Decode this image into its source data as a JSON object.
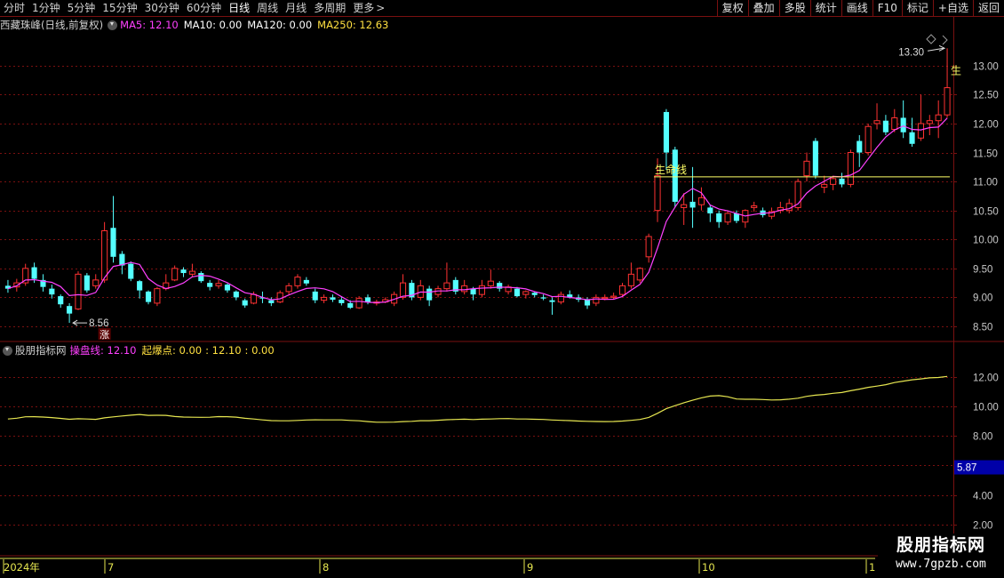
{
  "toolbar": {
    "tabs": [
      "分时",
      "1分钟",
      "5分钟",
      "15分钟",
      "30分钟",
      "60分钟",
      "日线",
      "周线",
      "月线",
      "多周期",
      "更多"
    ],
    "active_tab": "日线",
    "more_arrow": ">",
    "tools": [
      "复权",
      "叠加",
      "多股",
      "统计",
      "画线",
      "F10",
      "标记",
      "+自选",
      "返回"
    ]
  },
  "main_legend": {
    "stock": "西藏珠峰(日线,前复权)",
    "ma5": "MA5: 12.10",
    "ma10": "MA10: 0.00",
    "ma120": "MA120: 0.00",
    "ma250": "MA250: 12.63"
  },
  "sub_legend": {
    "name": "股朋指标网",
    "line1": "操盘线: 12.10",
    "line2": "起爆点: 0.00",
    "line3": ": 12.10",
    "line4": ": 0.00"
  },
  "annotations": {
    "high_label": "13.30",
    "low_label": "8.56",
    "low_marker": "涨",
    "support_label": "生命线",
    "edge_marker": "生",
    "sub_value_box": "5.87"
  },
  "watermark": {
    "line1": "股朋指标网",
    "line2": "www.7gpzb.com"
  },
  "colors": {
    "up": "#ff3232",
    "down": "#54ffff",
    "ma5": "#ff40ff",
    "indicator": "#e6e650",
    "grid": "#7a1010",
    "axis_text": "#c8c8c8",
    "support": "#ffff66",
    "value_box": "#0000a8"
  },
  "chart_data": [
    {
      "type": "candlestick",
      "x_ticks": [
        "2024年",
        "7",
        "8",
        "9",
        "10",
        "1"
      ],
      "y_ticks": [
        8.5,
        9.0,
        9.5,
        10.0,
        10.5,
        11.0,
        11.5,
        12.0,
        12.5,
        13.0
      ],
      "ylim": [
        8.3,
        13.55
      ],
      "candles": [
        {
          "o": 9.2,
          "h": 9.3,
          "l": 9.08,
          "c": 9.15
        },
        {
          "o": 9.18,
          "h": 9.32,
          "l": 9.1,
          "c": 9.25
        },
        {
          "o": 9.25,
          "h": 9.58,
          "l": 9.2,
          "c": 9.5
        },
        {
          "o": 9.52,
          "h": 9.6,
          "l": 9.25,
          "c": 9.32
        },
        {
          "o": 9.3,
          "h": 9.4,
          "l": 9.1,
          "c": 9.18
        },
        {
          "o": 9.15,
          "h": 9.22,
          "l": 8.98,
          "c": 9.05
        },
        {
          "o": 9.02,
          "h": 9.05,
          "l": 8.82,
          "c": 8.88
        },
        {
          "o": 8.85,
          "h": 8.9,
          "l": 8.56,
          "c": 8.72
        },
        {
          "o": 8.8,
          "h": 9.45,
          "l": 8.78,
          "c": 9.4
        },
        {
          "o": 9.38,
          "h": 9.42,
          "l": 9.08,
          "c": 9.12
        },
        {
          "o": 9.2,
          "h": 9.4,
          "l": 9.15,
          "c": 9.3
        },
        {
          "o": 9.3,
          "h": 10.3,
          "l": 9.25,
          "c": 10.15
        },
        {
          "o": 10.2,
          "h": 10.75,
          "l": 9.6,
          "c": 9.7
        },
        {
          "o": 9.75,
          "h": 9.8,
          "l": 9.4,
          "c": 9.55
        },
        {
          "o": 9.58,
          "h": 9.62,
          "l": 9.28,
          "c": 9.32
        },
        {
          "o": 9.28,
          "h": 9.3,
          "l": 8.98,
          "c": 9.12
        },
        {
          "o": 9.1,
          "h": 9.12,
          "l": 8.88,
          "c": 8.92
        },
        {
          "o": 8.9,
          "h": 9.18,
          "l": 8.85,
          "c": 9.15
        },
        {
          "o": 9.15,
          "h": 9.4,
          "l": 9.12,
          "c": 9.25
        },
        {
          "o": 9.3,
          "h": 9.55,
          "l": 9.28,
          "c": 9.5
        },
        {
          "o": 9.48,
          "h": 9.52,
          "l": 9.35,
          "c": 9.42
        },
        {
          "o": 9.4,
          "h": 9.58,
          "l": 9.35,
          "c": 9.45
        },
        {
          "o": 9.42,
          "h": 9.45,
          "l": 9.25,
          "c": 9.28
        },
        {
          "o": 9.25,
          "h": 9.3,
          "l": 9.12,
          "c": 9.18
        },
        {
          "o": 9.2,
          "h": 9.3,
          "l": 9.15,
          "c": 9.24
        },
        {
          "o": 9.22,
          "h": 9.24,
          "l": 9.08,
          "c": 9.12
        },
        {
          "o": 9.1,
          "h": 9.12,
          "l": 8.95,
          "c": 9.0
        },
        {
          "o": 8.95,
          "h": 8.98,
          "l": 8.82,
          "c": 8.86
        },
        {
          "o": 8.9,
          "h": 9.1,
          "l": 8.88,
          "c": 9.05
        },
        {
          "o": 9.0,
          "h": 9.1,
          "l": 8.9,
          "c": 8.98
        },
        {
          "o": 8.95,
          "h": 9.0,
          "l": 8.85,
          "c": 8.9
        },
        {
          "o": 8.92,
          "h": 9.12,
          "l": 8.9,
          "c": 9.08
        },
        {
          "o": 9.1,
          "h": 9.25,
          "l": 9.05,
          "c": 9.2
        },
        {
          "o": 9.2,
          "h": 9.4,
          "l": 9.15,
          "c": 9.35
        },
        {
          "o": 9.3,
          "h": 9.35,
          "l": 9.2,
          "c": 9.24
        },
        {
          "o": 9.1,
          "h": 9.15,
          "l": 8.9,
          "c": 8.95
        },
        {
          "o": 8.95,
          "h": 9.05,
          "l": 8.9,
          "c": 9.0
        },
        {
          "o": 9.0,
          "h": 9.05,
          "l": 8.92,
          "c": 8.96
        },
        {
          "o": 8.96,
          "h": 9.02,
          "l": 8.86,
          "c": 8.9
        },
        {
          "o": 8.9,
          "h": 8.95,
          "l": 8.8,
          "c": 8.82
        },
        {
          "o": 8.82,
          "h": 9.02,
          "l": 8.8,
          "c": 8.98
        },
        {
          "o": 9.0,
          "h": 9.05,
          "l": 8.88,
          "c": 8.92
        },
        {
          "o": 8.9,
          "h": 8.96,
          "l": 8.86,
          "c": 8.92
        },
        {
          "o": 8.92,
          "h": 9.0,
          "l": 8.9,
          "c": 8.96
        },
        {
          "o": 8.9,
          "h": 9.1,
          "l": 8.85,
          "c": 9.05
        },
        {
          "o": 9.0,
          "h": 9.4,
          "l": 8.96,
          "c": 9.25
        },
        {
          "o": 9.25,
          "h": 9.3,
          "l": 8.95,
          "c": 9.0
        },
        {
          "o": 9.0,
          "h": 9.3,
          "l": 8.95,
          "c": 9.2
        },
        {
          "o": 9.15,
          "h": 9.2,
          "l": 8.85,
          "c": 8.95
        },
        {
          "o": 9.05,
          "h": 9.2,
          "l": 9.0,
          "c": 9.15
        },
        {
          "o": 9.15,
          "h": 9.6,
          "l": 9.1,
          "c": 9.25
        },
        {
          "o": 9.3,
          "h": 9.35,
          "l": 9.05,
          "c": 9.1
        },
        {
          "o": 9.1,
          "h": 9.3,
          "l": 9.05,
          "c": 9.2
        },
        {
          "o": 9.15,
          "h": 9.18,
          "l": 8.95,
          "c": 9.05
        },
        {
          "o": 9.05,
          "h": 9.3,
          "l": 9.0,
          "c": 9.2
        },
        {
          "o": 9.2,
          "h": 9.48,
          "l": 9.15,
          "c": 9.28
        },
        {
          "o": 9.25,
          "h": 9.28,
          "l": 9.1,
          "c": 9.15
        },
        {
          "o": 9.1,
          "h": 9.22,
          "l": 9.05,
          "c": 9.18
        },
        {
          "o": 9.15,
          "h": 9.18,
          "l": 9.0,
          "c": 9.02
        },
        {
          "o": 9.05,
          "h": 9.12,
          "l": 8.98,
          "c": 9.1
        },
        {
          "o": 9.08,
          "h": 9.1,
          "l": 9.0,
          "c": 9.04
        },
        {
          "o": 9.0,
          "h": 9.05,
          "l": 8.95,
          "c": 8.98
        },
        {
          "o": 8.95,
          "h": 9.0,
          "l": 8.7,
          "c": 8.92
        },
        {
          "o": 8.92,
          "h": 9.1,
          "l": 8.88,
          "c": 9.05
        },
        {
          "o": 9.05,
          "h": 9.12,
          "l": 8.98,
          "c": 9.0
        },
        {
          "o": 9.0,
          "h": 9.05,
          "l": 8.92,
          "c": 8.96
        },
        {
          "o": 8.96,
          "h": 9.0,
          "l": 8.8,
          "c": 8.86
        },
        {
          "o": 8.9,
          "h": 9.05,
          "l": 8.85,
          "c": 9.0
        },
        {
          "o": 8.98,
          "h": 9.05,
          "l": 8.95,
          "c": 9.0
        },
        {
          "o": 9.0,
          "h": 9.08,
          "l": 8.96,
          "c": 9.02
        },
        {
          "o": 9.05,
          "h": 9.25,
          "l": 9.02,
          "c": 9.2
        },
        {
          "o": 9.2,
          "h": 9.6,
          "l": 9.15,
          "c": 9.4
        },
        {
          "o": 9.3,
          "h": 9.52,
          "l": 9.25,
          "c": 9.5
        },
        {
          "o": 9.7,
          "h": 10.1,
          "l": 9.6,
          "c": 10.05
        },
        {
          "o": 10.5,
          "h": 11.4,
          "l": 10.3,
          "c": 11.1
        },
        {
          "o": 12.2,
          "h": 12.25,
          "l": 11.2,
          "c": 11.5
        },
        {
          "o": 11.55,
          "h": 11.6,
          "l": 10.55,
          "c": 10.65
        },
        {
          "o": 10.55,
          "h": 10.8,
          "l": 10.25,
          "c": 10.6
        },
        {
          "o": 10.65,
          "h": 11.25,
          "l": 10.2,
          "c": 10.55
        },
        {
          "o": 10.6,
          "h": 10.9,
          "l": 10.5,
          "c": 10.72
        },
        {
          "o": 10.55,
          "h": 10.6,
          "l": 10.3,
          "c": 10.45
        },
        {
          "o": 10.45,
          "h": 10.5,
          "l": 10.2,
          "c": 10.3
        },
        {
          "o": 10.3,
          "h": 10.5,
          "l": 10.25,
          "c": 10.45
        },
        {
          "o": 10.45,
          "h": 10.5,
          "l": 10.28,
          "c": 10.32
        },
        {
          "o": 10.3,
          "h": 10.52,
          "l": 10.2,
          "c": 10.5
        },
        {
          "o": 10.55,
          "h": 10.65,
          "l": 10.48,
          "c": 10.58
        },
        {
          "o": 10.5,
          "h": 10.55,
          "l": 10.38,
          "c": 10.42
        },
        {
          "o": 10.4,
          "h": 10.55,
          "l": 10.35,
          "c": 10.48
        },
        {
          "o": 10.5,
          "h": 10.65,
          "l": 10.45,
          "c": 10.55
        },
        {
          "o": 10.5,
          "h": 10.7,
          "l": 10.45,
          "c": 10.62
        },
        {
          "o": 10.55,
          "h": 11.05,
          "l": 10.5,
          "c": 11.0
        },
        {
          "o": 11.1,
          "h": 11.5,
          "l": 11.0,
          "c": 11.35
        },
        {
          "o": 11.7,
          "h": 11.75,
          "l": 11.05,
          "c": 11.1
        },
        {
          "o": 10.9,
          "h": 11.1,
          "l": 10.8,
          "c": 10.95
        },
        {
          "o": 10.95,
          "h": 11.1,
          "l": 10.85,
          "c": 11.05
        },
        {
          "o": 11.05,
          "h": 11.15,
          "l": 10.9,
          "c": 10.95
        },
        {
          "o": 10.95,
          "h": 11.55,
          "l": 10.9,
          "c": 11.5
        },
        {
          "o": 11.7,
          "h": 11.8,
          "l": 11.25,
          "c": 11.5
        },
        {
          "o": 11.5,
          "h": 12.0,
          "l": 11.45,
          "c": 11.95
        },
        {
          "o": 12.0,
          "h": 12.35,
          "l": 11.9,
          "c": 12.05
        },
        {
          "o": 12.05,
          "h": 12.15,
          "l": 11.8,
          "c": 11.85
        },
        {
          "o": 11.9,
          "h": 12.25,
          "l": 11.85,
          "c": 12.1
        },
        {
          "o": 12.1,
          "h": 12.4,
          "l": 11.75,
          "c": 11.85
        },
        {
          "o": 11.85,
          "h": 12.1,
          "l": 11.6,
          "c": 11.65
        },
        {
          "o": 11.75,
          "h": 12.5,
          "l": 11.7,
          "c": 12.0
        },
        {
          "o": 12.0,
          "h": 12.15,
          "l": 11.8,
          "c": 12.05
        },
        {
          "o": 12.05,
          "h": 12.4,
          "l": 11.75,
          "c": 12.15
        },
        {
          "o": 12.15,
          "h": 13.3,
          "l": 12.1,
          "c": 12.62
        }
      ],
      "support_level": 11.08
    },
    {
      "type": "line",
      "y_ticks": [
        2.0,
        4.0,
        6.0,
        8.0,
        10.0,
        12.0
      ],
      "ylim": [
        1.5,
        13.2
      ],
      "value_box": 5.87
    }
  ]
}
